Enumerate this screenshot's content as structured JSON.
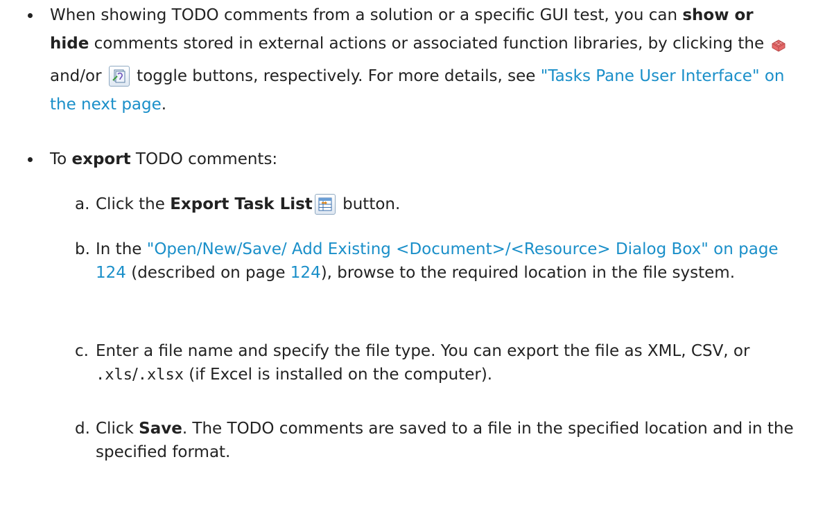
{
  "bullets": [
    {
      "before": "When showing TODO comments from a solution or a specific GUI test, you can ",
      "bold": "show or hide",
      "middle": " comments stored in external actions or associated function libraries, by clicking the ",
      "between_icons": " and/or ",
      "after_icons": " toggle buttons, respectively. For more details, see ",
      "link": "\"Tasks Pane User Interface\" on the next page",
      "end": ".",
      "icon_1": "lego-brick-icon",
      "icon_2": "function-library-icon"
    },
    {
      "before": "To ",
      "bold": "export",
      "after": " TODO comments:"
    }
  ],
  "steps": [
    {
      "letter": "a.",
      "before": "Click the ",
      "bold": "Export Task List",
      "icon": "export-task-list-icon",
      "after": " button."
    },
    {
      "letter": "b.",
      "before": "In the ",
      "link": "\"Open/New/Save/ Add Existing <Document>/<Resource> Dialog Box\" on page 124",
      "middle": " (described on page ",
      "page_link": "124",
      "after": "), browse to the required location in the file system."
    },
    {
      "letter": "c.",
      "before": "Enter a file name and specify the file type. You can export the file as XML, CSV, or ",
      "code1": ".xls",
      "slash": "/",
      "code2": ".xlsx",
      "after": " (if Excel is installed on the computer)."
    },
    {
      "letter": "d.",
      "before": "Click ",
      "bold": "Save",
      "after": ". The TODO comments are saved to a file in the specified location and in the specified format."
    }
  ],
  "colors": {
    "link": "#1a8fc9",
    "text": "#222222"
  }
}
